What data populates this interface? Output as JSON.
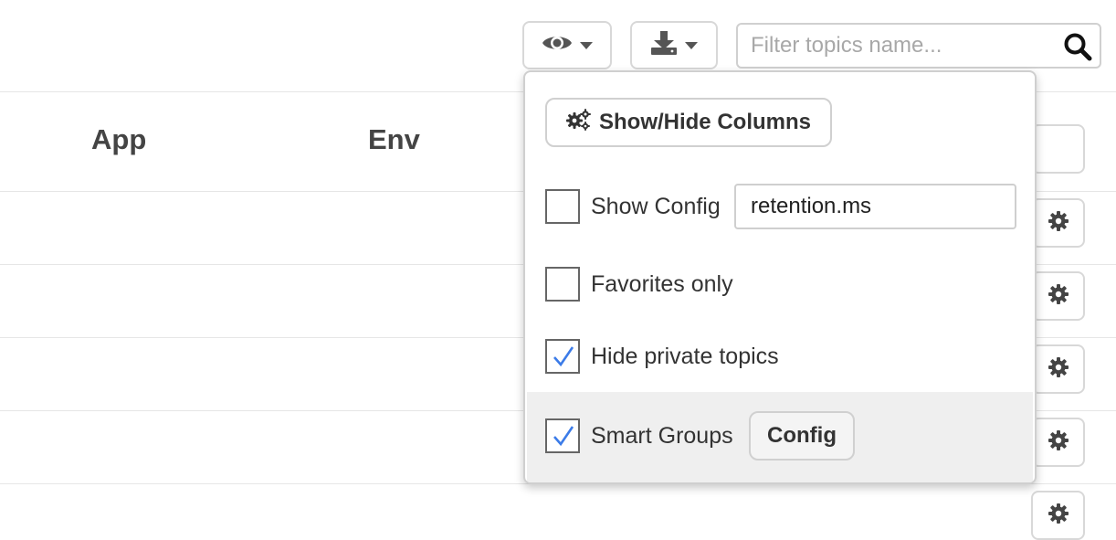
{
  "toolbar": {
    "view_icon": "eye-icon",
    "download_icon": "download-icon",
    "search": {
      "placeholder": "Filter topics name...",
      "value": ""
    }
  },
  "table": {
    "columns": [
      "App",
      "Env"
    ],
    "rows": [
      {
        "action_icon": "gear-icon"
      },
      {
        "action_icon": "gear-icon"
      },
      {
        "action_icon": "gear-icon"
      },
      {
        "action_icon": "gear-icon"
      }
    ]
  },
  "dropdown": {
    "title": "Show/Hide Columns",
    "title_icon": "gears-icon",
    "options": {
      "show_config": {
        "label": "Show Config",
        "checked": false,
        "input_value": "retention.ms"
      },
      "favorites_only": {
        "label": "Favorites only",
        "checked": false
      },
      "hide_private": {
        "label": "Hide private topics",
        "checked": true
      },
      "smart_groups": {
        "label": "Smart Groups",
        "checked": true,
        "button_label": "Config"
      }
    }
  },
  "colors": {
    "check": "#3b7be8",
    "highlight_row": "#efefef",
    "border": "#d8d8d8"
  }
}
